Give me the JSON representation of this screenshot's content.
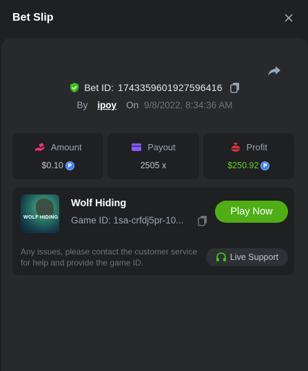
{
  "header": {
    "title": "Bet Slip"
  },
  "bet": {
    "id_label": "Bet ID:",
    "id_value": "1743359601927596416",
    "by_label": "By",
    "user": "ipoy",
    "on_label": "On",
    "datetime": "9/8/2022, 8:34:36 AM"
  },
  "stats": {
    "amount": {
      "label": "Amount",
      "value": "$0.10",
      "icon": "money-hand-icon",
      "color": "#e8336f"
    },
    "payout": {
      "label": "Payout",
      "value": "2505 x",
      "icon": "card-icon",
      "color": "#8a5cf6"
    },
    "profit": {
      "label": "Profit",
      "value": "$250.92",
      "icon": "bag-icon",
      "color": "#e0303a",
      "value_color": "#5ed11f"
    }
  },
  "game": {
    "thumb_text": "WOLF HIDING",
    "name": "Wolf Hiding",
    "id_text": "Game ID: 1sa-crfdj5pr-10...",
    "play_label": "Play Now",
    "issue_text": "Any issues, please contact the customer service for help and provide the game ID.",
    "support_label": "Live Support"
  },
  "colors": {
    "accent": "#4fae16",
    "coin": "#3b82f6"
  }
}
